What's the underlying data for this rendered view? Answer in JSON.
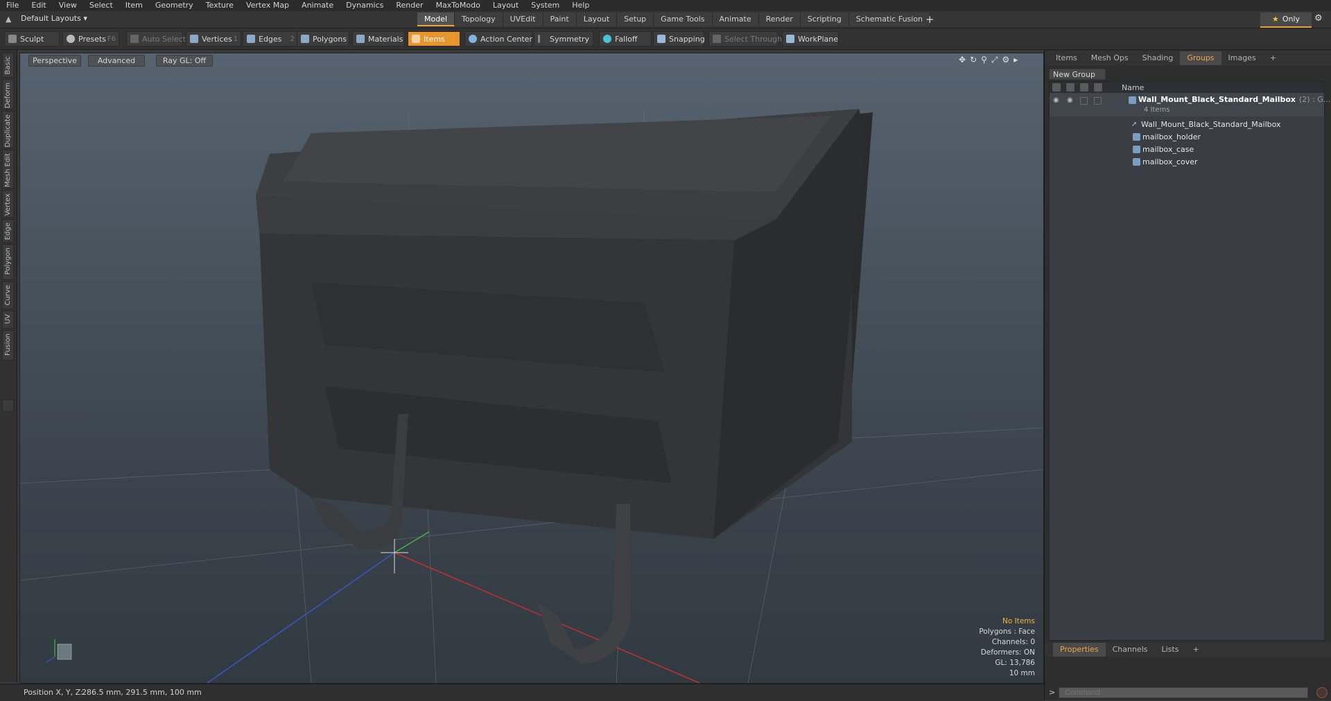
{
  "menu": [
    "File",
    "Edit",
    "View",
    "Select",
    "Item",
    "Geometry",
    "Texture",
    "Vertex Map",
    "Animate",
    "Dynamics",
    "Render",
    "MaxToModo",
    "Layout",
    "System",
    "Help"
  ],
  "layout_dropdown": "Default Layouts",
  "mode_tabs": [
    "Model",
    "Topology",
    "UVEdit",
    "Paint",
    "Layout",
    "Setup",
    "Game Tools",
    "Animate",
    "Render",
    "Scripting",
    "Schematic Fusion"
  ],
  "active_mode_tab": "Model",
  "only_button": "Only",
  "toolbar": {
    "sculpt": "Sculpt",
    "presets": "Presets",
    "presets_key": "F6",
    "auto_select": "Auto Select",
    "vertices": "Vertices",
    "vertices_key": "1",
    "edges": "Edges",
    "edges_key": "2",
    "polygons": "Polygons",
    "materials": "Materials",
    "items": "Items",
    "action_center": "Action Center",
    "symmetry": "Symmetry",
    "falloff": "Falloff",
    "snapping": "Snapping",
    "select_through": "Select Through",
    "workplane": "WorkPlane"
  },
  "left_tabs": [
    "Basic",
    "Deform",
    "Duplicate",
    "Mesh Edit",
    "Vertex",
    "Edge",
    "Polygon",
    "Curve",
    "UV",
    "Fusion"
  ],
  "viewport": {
    "view": "Perspective",
    "shading": "Advanced",
    "raygl": "Ray GL: Off",
    "info": {
      "no_items": "No Items",
      "polygons": "Polygons : Face",
      "channels": "Channels: 0",
      "deformers": "Deformers: ON",
      "gl": "GL: 13,786",
      "scale": "10 mm"
    }
  },
  "status": {
    "position_label": "Position X, Y, Z:",
    "position_value": "286.5 mm, 291.5 mm, 100 mm"
  },
  "right_panel": {
    "tabs": [
      "Items",
      "Mesh Ops",
      "Shading",
      "Groups",
      "Images"
    ],
    "active_tab": "Groups",
    "new_group": "New Group",
    "column_name": "Name",
    "root": {
      "name": "Wall_Mount_Black_Standard_Mailbox",
      "suffix": "(2) : G...",
      "count": "4 Items"
    },
    "children": [
      "Wall_Mount_Black_Standard_Mailbox",
      "mailbox_holder",
      "mailbox_case",
      "mailbox_cover"
    ],
    "bottom_tabs": [
      "Properties",
      "Channels",
      "Lists"
    ],
    "active_bottom_tab": "Properties",
    "command_placeholder": "Command"
  },
  "colors": {
    "accent": "#e8952b",
    "active_tab_text": "#f0a64a"
  }
}
